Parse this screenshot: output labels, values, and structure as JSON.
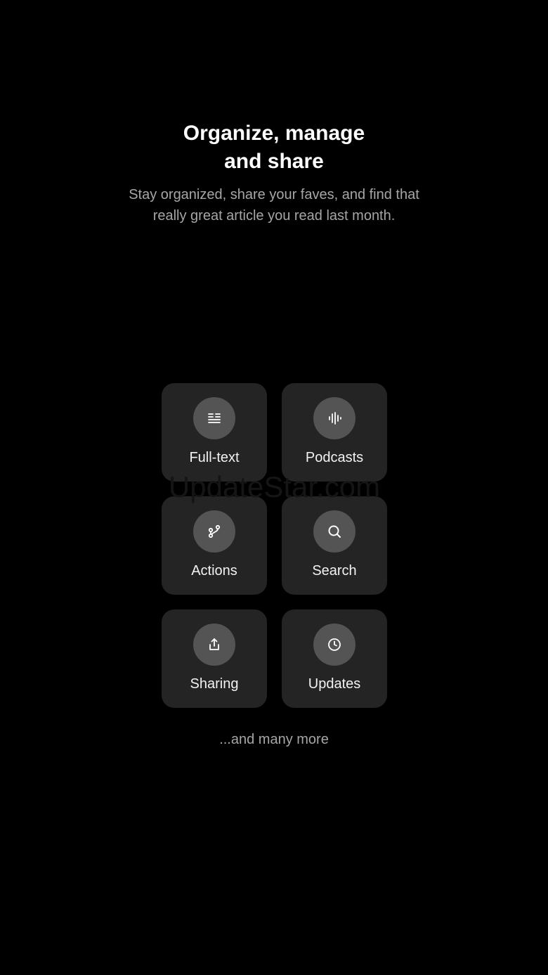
{
  "header": {
    "title_line1": "Organize, manage",
    "title_line2": "and share",
    "subtitle_line1": "Stay organized, share your faves, and find that",
    "subtitle_line2": "really great article you read last month."
  },
  "features": [
    {
      "label": "Full-text",
      "icon": "full-text-icon"
    },
    {
      "label": "Podcasts",
      "icon": "audio-waveform-icon"
    },
    {
      "label": "Actions",
      "icon": "git-branch-icon"
    },
    {
      "label": "Search",
      "icon": "search-icon"
    },
    {
      "label": "Sharing",
      "icon": "share-upload-icon"
    },
    {
      "label": "Updates",
      "icon": "clock-icon"
    }
  ],
  "watermark": "UpdateStar.com",
  "footer": {
    "more_text": "...and many more"
  },
  "colors": {
    "background": "#000000",
    "tile": "#242424",
    "icon_circle": "#545454",
    "muted_text": "#a6a6a6"
  }
}
